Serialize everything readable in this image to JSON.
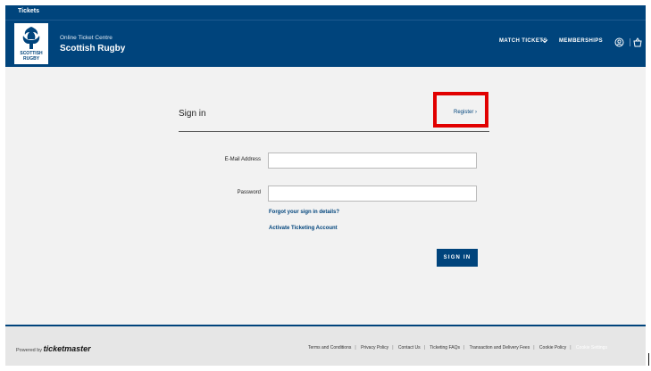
{
  "topbar": {
    "tab_label": "Tickets"
  },
  "header": {
    "brand_subtitle": "Online Ticket Centre",
    "brand_title": "Scottish Rugby",
    "logo_text_line1": "SCOTTISH",
    "logo_text_line2": "RUGBY",
    "nav_match_tickets": "MATCH TICKETS",
    "nav_memberships": "MEMBERSHIPS",
    "icons": [
      "account-icon",
      "basket-icon",
      "chevron-down-icon"
    ]
  },
  "signin": {
    "title": "Sign in",
    "register_label": "Register ›",
    "email_label": "E-Mail Address",
    "email_value": "",
    "password_label": "Password",
    "password_value": "",
    "forgot_link": "Forgot your sign in details?",
    "activate_link": "Activate Ticketing Account",
    "submit_label": "SIGN IN"
  },
  "footer": {
    "powered_by": "Powered by",
    "ticketmaster": "ticketmaster",
    "links": [
      "Terms and Conditions",
      "Privacy Policy",
      "Contact Us",
      "Ticketing FAQs",
      "Transaction and Delivery Fees",
      "Cookie Policy"
    ],
    "cookie_settings": "Cookie Settings"
  },
  "colors": {
    "brand_blue": "#00447c",
    "highlight_red": "#e10000",
    "page_bg": "#f2f2f2"
  }
}
